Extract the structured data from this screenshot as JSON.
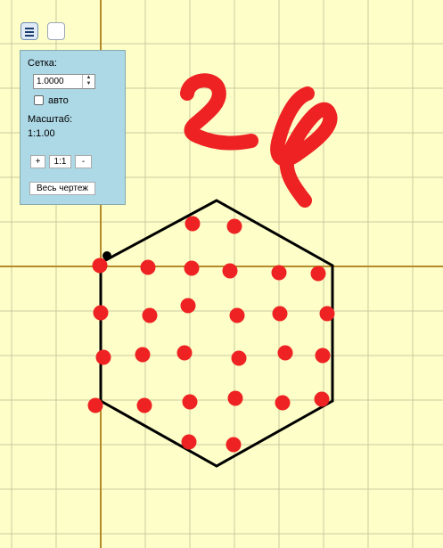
{
  "colors": {
    "background": "#fefec8",
    "grid": "#c9c9a0",
    "axis": "#b58a2a",
    "hexagon": "#000000",
    "dots": "#ee2222",
    "handwriting": "#ee2222",
    "panel": "#add8e6"
  },
  "toolbar": {
    "menu_icon": "hamburger-icon"
  },
  "panel": {
    "grid_label": "Сетка:",
    "grid_value": "1.0000",
    "auto_label": "авто",
    "auto_checked": false,
    "scale_label": "Масштаб:",
    "scale_value": "1:1.00",
    "zoom_in_label": "+",
    "zoom_reset_label": "1:1",
    "zoom_out_label": "-",
    "fit_label": "Весь чертеж"
  },
  "drawing": {
    "dot_count": 29
  }
}
